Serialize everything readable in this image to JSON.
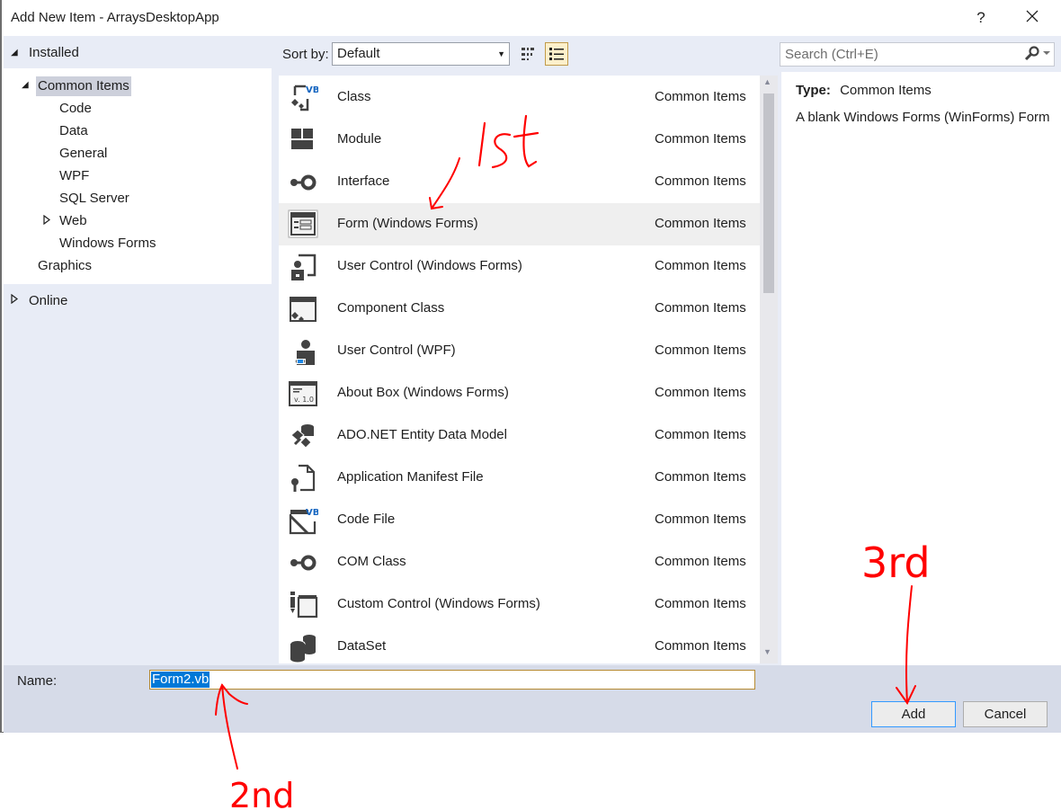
{
  "window": {
    "title": "Add New Item - ArraysDesktopApp",
    "help_label": "?",
    "close_label": "✕"
  },
  "tree": {
    "installed_label": "Installed",
    "online_label": "Online",
    "items": [
      {
        "label": "Common Items",
        "selected": true
      },
      {
        "label": "Code"
      },
      {
        "label": "Data"
      },
      {
        "label": "General"
      },
      {
        "label": "WPF"
      },
      {
        "label": "SQL Server"
      },
      {
        "label": "Web",
        "expandable": true
      },
      {
        "label": "Windows Forms"
      },
      {
        "label": "Graphics"
      }
    ]
  },
  "toolbar": {
    "sort_label": "Sort by:",
    "sort_value": "Default",
    "search_placeholder": "Search (Ctrl+E)",
    "view_modes": [
      "medium-icons",
      "list"
    ],
    "active_view": "list"
  },
  "templates": [
    {
      "name": "Class",
      "category": "Common Items",
      "icon": "vb-class-icon"
    },
    {
      "name": "Module",
      "category": "Common Items",
      "icon": "module-icon"
    },
    {
      "name": "Interface",
      "category": "Common Items",
      "icon": "interface-icon"
    },
    {
      "name": "Form (Windows Forms)",
      "category": "Common Items",
      "icon": "windows-form-icon",
      "selected": true
    },
    {
      "name": "User Control (Windows Forms)",
      "category": "Common Items",
      "icon": "user-control-icon"
    },
    {
      "name": "Component Class",
      "category": "Common Items",
      "icon": "component-class-icon"
    },
    {
      "name": "User Control (WPF)",
      "category": "Common Items",
      "icon": "wpf-user-control-icon"
    },
    {
      "name": "About Box (Windows Forms)",
      "category": "Common Items",
      "icon": "about-box-icon"
    },
    {
      "name": "ADO.NET Entity Data Model",
      "category": "Common Items",
      "icon": "entity-model-icon"
    },
    {
      "name": "Application Manifest File",
      "category": "Common Items",
      "icon": "manifest-file-icon"
    },
    {
      "name": "Code File",
      "category": "Common Items",
      "icon": "vb-code-file-icon"
    },
    {
      "name": "COM Class",
      "category": "Common Items",
      "icon": "com-class-icon"
    },
    {
      "name": "Custom Control (Windows Forms)",
      "category": "Common Items",
      "icon": "custom-control-icon"
    },
    {
      "name": "DataSet",
      "category": "Common Items",
      "icon": "dataset-icon"
    }
  ],
  "details": {
    "type_label": "Type:",
    "type_value": "Common Items",
    "description": "A blank Windows Forms (WinForms) Form"
  },
  "footer": {
    "name_label": "Name:",
    "name_value": "Form2.vb",
    "add_label": "Add",
    "cancel_label": "Cancel"
  },
  "annotations": {
    "first": "1st",
    "second": "2nd",
    "third": "3rd",
    "color": "#ff0000"
  },
  "colors": {
    "selection_blue": "#0078d7",
    "panel_bg": "#e8ecf6",
    "footer_bg": "#d6dbe8",
    "active_view_bg": "#fdf0cb"
  }
}
